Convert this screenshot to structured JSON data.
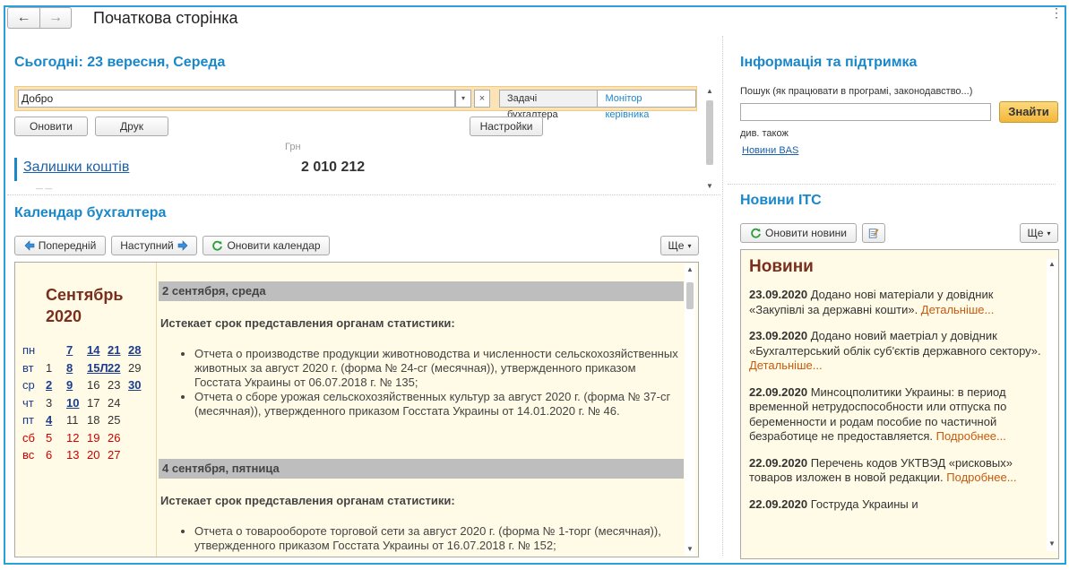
{
  "header": {
    "title": "Початкова сторінка",
    "back_glyph": "←",
    "forward_glyph": "→",
    "more_glyph": "⋮"
  },
  "today": {
    "title": "Сьогодні: 23 вересня, Середа",
    "filter_value": "Добро",
    "dropdown_glyph": "▾",
    "clear_glyph": "×",
    "tabs": [
      {
        "label": "Задачі бухгалтера"
      },
      {
        "label": "Монітор керівника"
      }
    ],
    "refresh_label": "Оновити",
    "print_label": "Друк",
    "settings_label": "Настройки",
    "currency": "Грн",
    "balance_label": "Залишки коштів",
    "balance_value": "2 010 212"
  },
  "calendar": {
    "title": "Календар бухгалтера",
    "prev_label": "Попередній",
    "next_label": "Наступний",
    "refresh_label": "Оновити календар",
    "more_label": "Ще",
    "month_line1": "Сентябрь",
    "month_line2": "2020",
    "rows": [
      {
        "day": "пн",
        "cells": [
          "",
          "7",
          "14",
          "21",
          "28"
        ],
        "links": [
          false,
          true,
          true,
          true,
          true
        ],
        "weekend": false
      },
      {
        "day": "вт",
        "cells": [
          "1",
          "8",
          "15Л",
          "22",
          "29"
        ],
        "links": [
          false,
          true,
          true,
          true,
          false
        ],
        "weekend": false
      },
      {
        "day": "ср",
        "cells": [
          "2",
          "9",
          "16",
          "23",
          "30"
        ],
        "links": [
          true,
          true,
          false,
          false,
          true
        ],
        "weekend": false
      },
      {
        "day": "чт",
        "cells": [
          "3",
          "10",
          "17",
          "24",
          ""
        ],
        "links": [
          false,
          true,
          false,
          false,
          false
        ],
        "weekend": false
      },
      {
        "day": "пт",
        "cells": [
          "4",
          "11",
          "18",
          "25",
          ""
        ],
        "links": [
          true,
          false,
          false,
          false,
          false
        ],
        "weekend": false
      },
      {
        "day": "сб",
        "cells": [
          "5",
          "12",
          "19",
          "26",
          ""
        ],
        "links": [
          false,
          false,
          false,
          false,
          false
        ],
        "weekend": true
      },
      {
        "day": "вс",
        "cells": [
          "6",
          "13",
          "20",
          "27",
          ""
        ],
        "links": [
          false,
          false,
          false,
          false,
          false
        ],
        "weekend": true
      }
    ],
    "events": [
      {
        "date": "2 сентября, среда",
        "deadline": "Истекает срок представления органам статистики:",
        "items": [
          "Отчета о производстве продукции животноводства и численности сельскохозяйственных животных за август 2020 г. (форма № 24-сг (месячная)), утвержденного приказом Госстата Украины от 06.07.2018 г. № 135;",
          "Отчета о сборе урожая сельскохозяйственных культур за август 2020 г. (форма № 37-сг (месячная)), утвержденного приказом Госстата Украины от 14.01.2020 г. № 46."
        ]
      },
      {
        "date": "4 сентября, пятница",
        "deadline": "Истекает срок представления органам статистики:",
        "items": [
          "Отчета о товарообороте торговой сети за август 2020 г. (форма № 1-торг (месячная)), утвержденного приказом Госстата Украины от 16.07.2018 г. № 152;"
        ]
      }
    ]
  },
  "info": {
    "title": "Інформація та підтримка",
    "search_label": "Пошук (як працювати в програмі, законодавство...)",
    "search_value": "",
    "find_label": "Знайти",
    "see_also": "див. також",
    "bas_link": "Новини BAS"
  },
  "news": {
    "title": "Новини ІТС",
    "refresh_label": "Оновити новини",
    "more_label": "Ще",
    "box_title": "Новини",
    "items": [
      {
        "date": "23.09.2020",
        "text": " Додано нові матеріали у довідник «Закупівлі за державні кошти». ",
        "more": "Детальніше..."
      },
      {
        "date": "23.09.2020",
        "text": " Додано новий маетріал у довідник «Бухгалтерський облік суб'єктів державного сектору». ",
        "more": "Детальніше..."
      },
      {
        "date": "22.09.2020",
        "text": " Минсоцполитики Украины: в период временной нетрудоспособности или отпуска по беременности и родам пособие по частичной безработице не предоставляется. ",
        "more": "Подробнее..."
      },
      {
        "date": "22.09.2020",
        "text": " Перечень кодов УКТВЭД «рисковых» товаров изложен в новой редакции. ",
        "more": "Подробнее..."
      },
      {
        "date": "22.09.2020",
        "text": " Гоструда Украины и",
        "more": ""
      }
    ]
  },
  "colors": {
    "accent": "#1a87c9",
    "frame": "#2aa0d8",
    "month": "#7a2e1e",
    "highlight": "#fffbe6"
  }
}
